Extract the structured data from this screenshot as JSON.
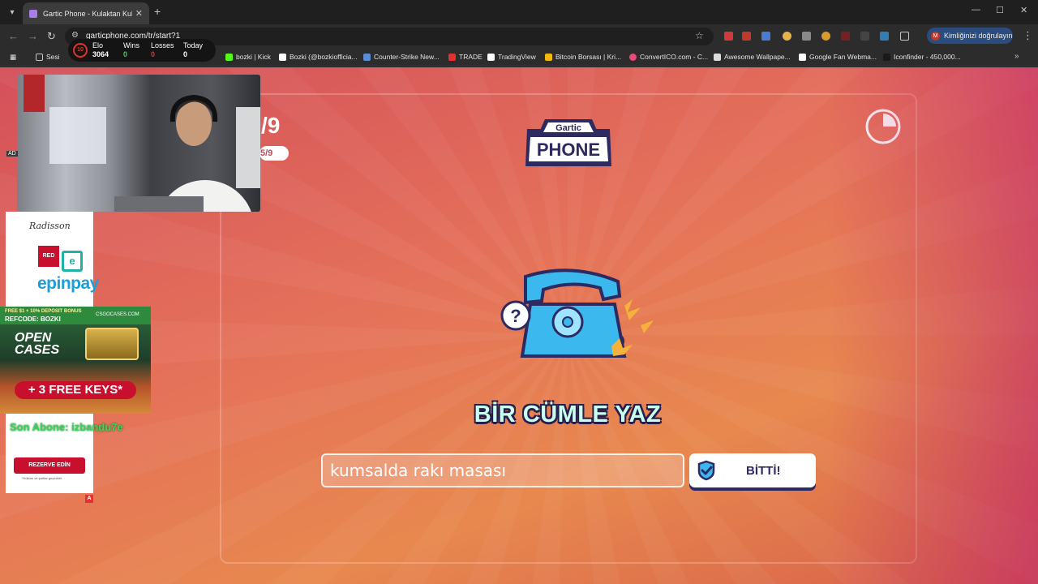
{
  "browser": {
    "tab_title": "Gartic Phone - Kulaktan Kulağa",
    "url": "garticphone.com/tr/start?1",
    "profile_label": "Kimliğinizi doğrulayın",
    "profile_initial": "M",
    "bookmarks_folder": "Sesi",
    "bookmarks": [
      {
        "label": "bozki | Kick",
        "color": "#53fc18"
      },
      {
        "label": "Bozki (@bozkiofficia...",
        "color": "#ffffff"
      },
      {
        "label": "Counter-Strike New...",
        "color": "#5b8dd6"
      },
      {
        "label": "TRADE",
        "color": "#e0322f"
      },
      {
        "label": "TradingView",
        "color": "#ffffff"
      },
      {
        "label": "Bitcoin Borsası | Kri...",
        "color": "#f0b90b"
      },
      {
        "label": "ConvertICO.com - C...",
        "color": "#e84a7a"
      },
      {
        "label": "Awesome Wallpape...",
        "color": "#dddddd"
      },
      {
        "label": "Google Fan Webma...",
        "color": "#ffffff"
      },
      {
        "label": "Iconfinder - 450,000...",
        "color": "#1a1a1a"
      }
    ]
  },
  "stream_stats": {
    "elo_label": "Elo",
    "elo_value": "3064",
    "wins_label": "Wins",
    "wins_value": "0",
    "losses_label": "Losses",
    "losses_value": "0",
    "today_label": "Today",
    "today_value": "0",
    "colors": {
      "wins": "#3cd45c",
      "losses": "#e0322f",
      "elo": "#ffffff"
    }
  },
  "game": {
    "round_number": "/9",
    "round_pill": "5/9",
    "logo_top": "Gartic",
    "logo_bottom": "PHONE",
    "instruction": "BİR CÜMLE YAZ",
    "input_value": "kumsalda rakı masası",
    "done_label": "BİTTİ!",
    "timer_elapsed_fraction": 0.25,
    "colors": {
      "instruction": "#c8fff0",
      "button_text": "#2d2a62",
      "accent_blue": "#3bb9ef"
    }
  },
  "overlays": {
    "ad_tag": "AD",
    "sponsor_radisson": "Radisson",
    "sponsor_red": "RED",
    "sponsor_e": "e",
    "sponsor_epinpay": "epinpay",
    "promo_bonus": "FREE $1 + 10% DEPOSIT BONUS",
    "promo_refcode": "REFCODE: BOZKI",
    "promo_site": "CSGOCASES.COM",
    "promo_open": "OPEN",
    "promo_cases": "CASES",
    "promo_keys": "+ 3 FREE KEYS*",
    "last_sub": "Son Abone: izbandu7e",
    "reserve_label": "REZERVE EDİN",
    "small_print": "*Hüküm ve şartlar geçerlidir",
    "badge": "A"
  }
}
